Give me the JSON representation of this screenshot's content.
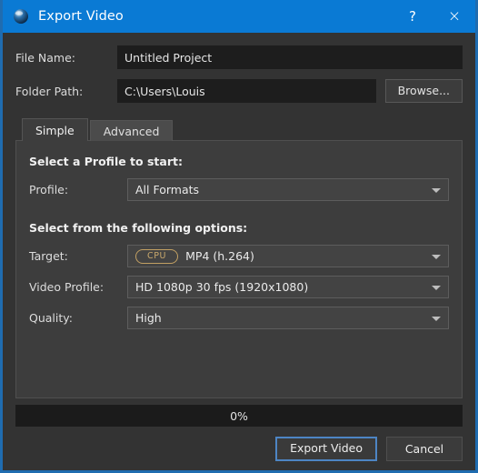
{
  "window": {
    "title": "Export Video",
    "icon": "openshot-sphere-icon",
    "help_label": "?",
    "close_label": "×",
    "accent_color": "#0a7ad4",
    "border_color": "#1f6cb0"
  },
  "form": {
    "file_name": {
      "label": "File Name:",
      "value": "Untitled Project",
      "placeholder": "File Name"
    },
    "folder_path": {
      "label": "Folder Path:",
      "value": "C:\\Users\\Louis",
      "placeholder": "Folder Path"
    },
    "browse_label": "Browse..."
  },
  "tabs": [
    {
      "label": "Simple",
      "active": true
    },
    {
      "label": "Advanced",
      "active": false
    }
  ],
  "simple_tab": {
    "profile_section": {
      "heading": "Select a Profile to start:",
      "profile": {
        "label": "Profile:",
        "value": "All Formats"
      }
    },
    "options_section": {
      "heading": "Select from the following options:",
      "target": {
        "label": "Target:",
        "badge": "CPU",
        "badge_color": "#c9a86c",
        "value": "MP4 (h.264)"
      },
      "video_profile": {
        "label": "Video Profile:",
        "value": "HD 1080p 30 fps (1920x1080)"
      },
      "quality": {
        "label": "Quality:",
        "value": "High"
      }
    }
  },
  "progress": {
    "text": "0%",
    "percent": 0
  },
  "actions": {
    "export_label": "Export Video",
    "cancel_label": "Cancel"
  }
}
